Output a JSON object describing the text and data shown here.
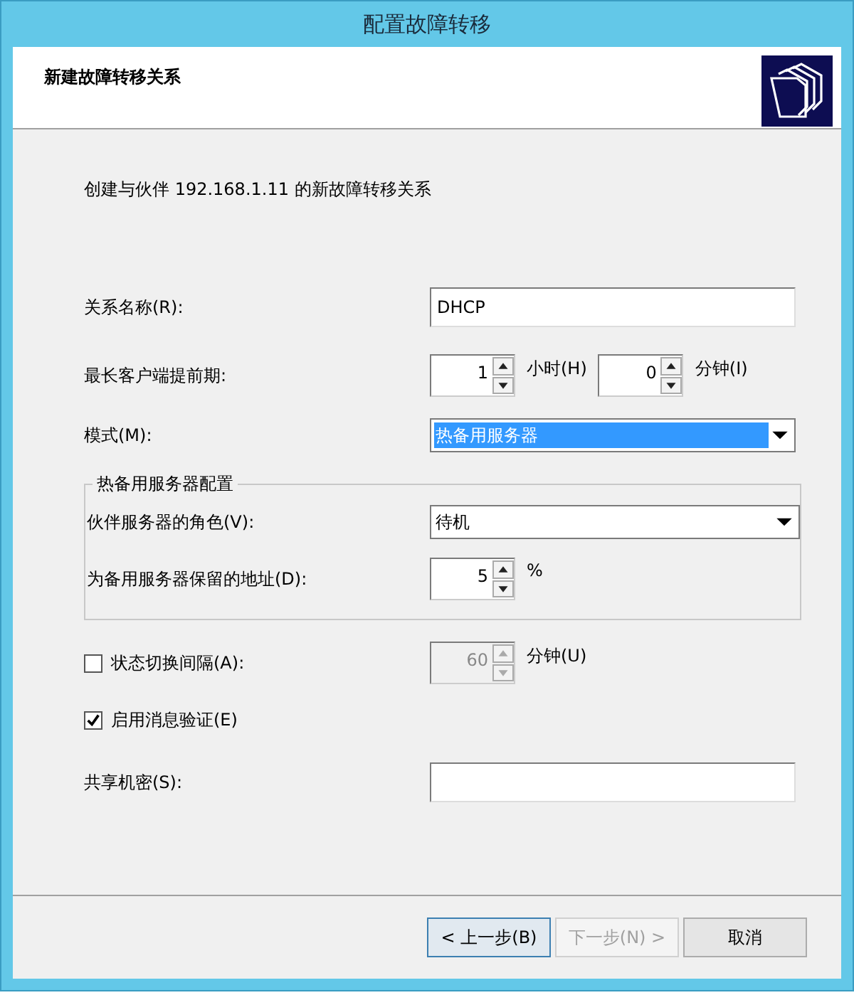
{
  "window": {
    "title": "配置故障转移"
  },
  "header": {
    "title": "新建故障转移关系"
  },
  "description": "创建与伙伴 192.168.1.11 的新故障转移关系",
  "relationship_name": {
    "label": "关系名称(R):",
    "value": "DHCP"
  },
  "max_client_lead_time": {
    "label": "最长客户端提前期:",
    "hours": {
      "value": "1",
      "unit": "小时(H)"
    },
    "minutes": {
      "value": "0",
      "unit": "分钟(I)"
    }
  },
  "mode": {
    "label": "模式(M):",
    "value": "热备用服务器",
    "focused": true
  },
  "hot_standby": {
    "title": "热备用服务器配置",
    "role": {
      "label": "伙伴服务器的角色(V):",
      "value": "待机"
    },
    "reserve": {
      "label": "为备用服务器保留的地址(D):",
      "value": "5",
      "unit": "%"
    }
  },
  "state_switchover": {
    "label": "状态切换间隔(A):",
    "checked": false,
    "value": "60",
    "unit": "分钟(U)",
    "disabled": true
  },
  "message_auth": {
    "label": "启用消息验证(E)",
    "checked": true
  },
  "shared_secret": {
    "label": "共享机密(S):"
  },
  "buttons": [
    {
      "label": "< 上一步(B)",
      "disabled": false,
      "default": true
    },
    {
      "label": "下一步(N) >",
      "disabled": true,
      "default": false
    },
    {
      "label": "取消",
      "disabled": false,
      "default": false
    }
  ]
}
